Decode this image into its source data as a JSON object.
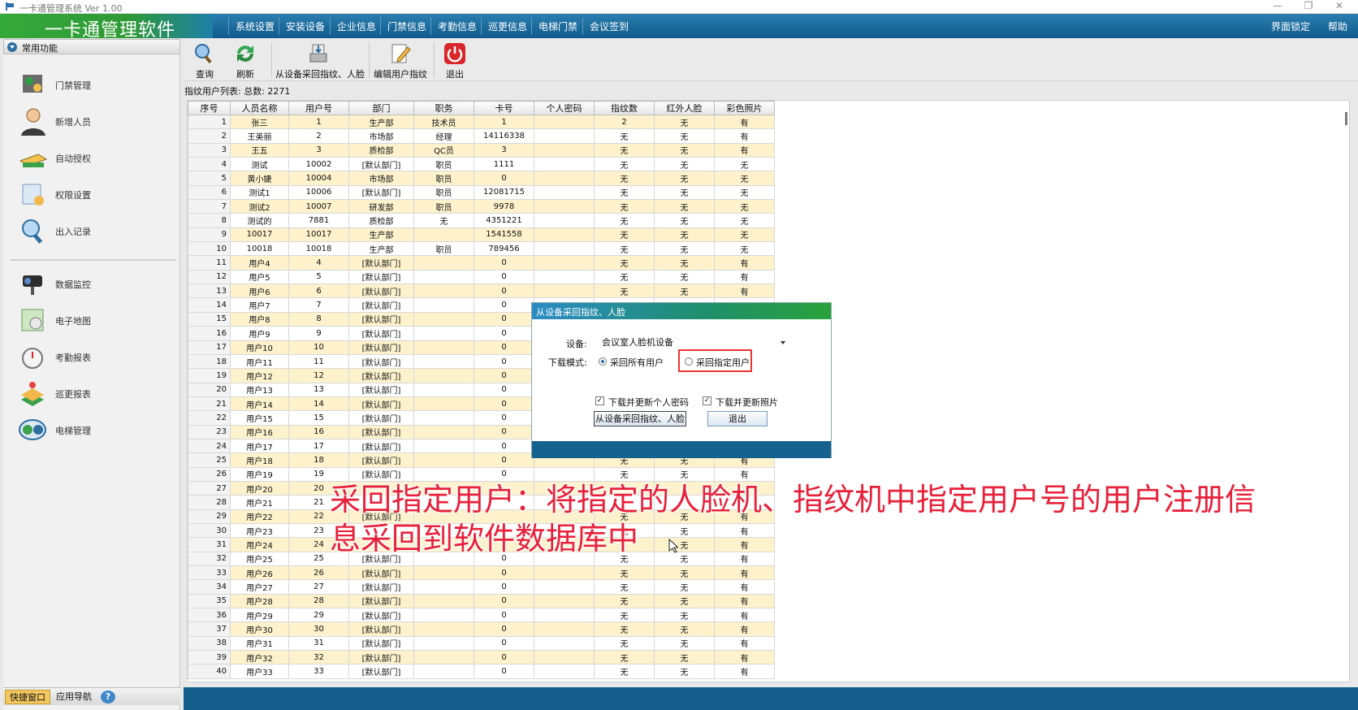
{
  "window": {
    "title": "一卡通管理系统  Ver 1.00",
    "min": "—",
    "max": "❐",
    "close": "✕"
  },
  "app": {
    "logo_text": "一卡通管理软件"
  },
  "menu": {
    "items": [
      "系统设置",
      "安装设备",
      "企业信息",
      "门禁信息",
      "考勤信息",
      "巡更信息",
      "电梯门禁",
      "会议签到"
    ],
    "right_items": [
      "界面锁定",
      "帮助"
    ]
  },
  "sidebar": {
    "header": "常用功能",
    "items": [
      {
        "label": "门禁管理",
        "icon": "door-access-icon"
      },
      {
        "label": "新增人员",
        "icon": "person-icon"
      },
      {
        "label": "自动授权",
        "icon": "card-icon"
      },
      {
        "label": "权限设置",
        "icon": "permission-icon"
      },
      {
        "label": "出入记录",
        "icon": "magnifier-icon"
      },
      {
        "label": "数据监控",
        "icon": "camera-icon"
      },
      {
        "label": "电子地图",
        "icon": "map-icon"
      },
      {
        "label": "考勤报表",
        "icon": "clock-icon"
      },
      {
        "label": "巡更报表",
        "icon": "patrol-icon"
      },
      {
        "label": "电梯管理",
        "icon": "elevator-icon"
      }
    ],
    "bottom_tabs": [
      "快捷窗口",
      "应用导航"
    ],
    "help_icon": "?"
  },
  "toolbar": {
    "buttons": [
      {
        "label": "查询",
        "icon": "search-icon"
      },
      {
        "label": "刷新",
        "icon": "refresh-icon"
      },
      {
        "label": "从设备采回指纹、人脸",
        "icon": "download-device-icon"
      },
      {
        "label": "编辑用户指纹",
        "icon": "edit-icon"
      },
      {
        "label": "退出",
        "icon": "power-icon"
      }
    ]
  },
  "list": {
    "label": "指纹用户列表: 总数: 2271",
    "columns": [
      "序号",
      "人员名称",
      "用户号",
      "部门",
      "职务",
      "卡号",
      "个人密码",
      "指纹数",
      "红外人脸",
      "彩色照片"
    ],
    "rows": [
      [
        "1",
        "张三",
        "1",
        "生产部",
        "技术员",
        "1",
        "",
        "2",
        "无",
        "有"
      ],
      [
        "2",
        "王美丽",
        "2",
        "市场部",
        "经理",
        "14116338",
        "",
        "无",
        "无",
        "有"
      ],
      [
        "3",
        "王五",
        "3",
        "质检部",
        "QC员",
        "3",
        "",
        "无",
        "无",
        "有"
      ],
      [
        "4",
        "测试",
        "10002",
        "[默认部门]",
        "职员",
        "1111",
        "",
        "无",
        "无",
        "无"
      ],
      [
        "5",
        "黄小婕",
        "10004",
        "市场部",
        "职员",
        "0",
        "",
        "无",
        "无",
        "无"
      ],
      [
        "6",
        "测试1",
        "10006",
        "[默认部门]",
        "职员",
        "12081715",
        "",
        "无",
        "无",
        "无"
      ],
      [
        "7",
        "测试2",
        "10007",
        "研发部",
        "职员",
        "9978",
        "",
        "无",
        "无",
        "无"
      ],
      [
        "8",
        "测试的",
        "7881",
        "质检部",
        "无",
        "4351221",
        "",
        "无",
        "无",
        "无"
      ],
      [
        "9",
        "10017",
        "10017",
        "生产部",
        "",
        "1541558",
        "",
        "无",
        "无",
        "无"
      ],
      [
        "10",
        "10018",
        "10018",
        "生产部",
        "职员",
        "789456",
        "",
        "无",
        "无",
        "无"
      ],
      [
        "11",
        "用户4",
        "4",
        "[默认部门]",
        "",
        "0",
        "",
        "无",
        "无",
        "有"
      ],
      [
        "12",
        "用户5",
        "5",
        "[默认部门]",
        "",
        "0",
        "",
        "无",
        "无",
        "有"
      ],
      [
        "13",
        "用户6",
        "6",
        "[默认部门]",
        "",
        "0",
        "",
        "无",
        "无",
        "有"
      ],
      [
        "14",
        "用户7",
        "7",
        "[默认部门]",
        "",
        "0",
        "",
        "",
        "",
        ""
      ],
      [
        "15",
        "用户8",
        "8",
        "[默认部门]",
        "",
        "0",
        "",
        "",
        "",
        ""
      ],
      [
        "16",
        "用户9",
        "9",
        "[默认部门]",
        "",
        "0",
        "",
        "",
        "",
        ""
      ],
      [
        "17",
        "用户10",
        "10",
        "[默认部门]",
        "",
        "0",
        "",
        "",
        "",
        ""
      ],
      [
        "18",
        "用户11",
        "11",
        "[默认部门]",
        "",
        "0",
        "",
        "",
        "",
        ""
      ],
      [
        "19",
        "用户12",
        "12",
        "[默认部门]",
        "",
        "0",
        "",
        "",
        "",
        ""
      ],
      [
        "20",
        "用户13",
        "13",
        "[默认部门]",
        "",
        "0",
        "",
        "",
        "",
        ""
      ],
      [
        "21",
        "用户14",
        "14",
        "[默认部门]",
        "",
        "0",
        "",
        "",
        "",
        ""
      ],
      [
        "22",
        "用户15",
        "15",
        "[默认部门]",
        "",
        "0",
        "",
        "",
        "",
        ""
      ],
      [
        "23",
        "用户16",
        "16",
        "[默认部门]",
        "",
        "0",
        "",
        "",
        "",
        ""
      ],
      [
        "24",
        "用户17",
        "17",
        "[默认部门]",
        "",
        "0",
        "",
        "",
        "",
        ""
      ],
      [
        "25",
        "用户18",
        "18",
        "[默认部门]",
        "",
        "0",
        "",
        "无",
        "无",
        "有"
      ],
      [
        "26",
        "用户19",
        "19",
        "[默认部门]",
        "",
        "0",
        "",
        "无",
        "无",
        "有"
      ],
      [
        "27",
        "用户20",
        "20",
        "",
        "",
        "",
        "",
        "",
        "",
        ""
      ],
      [
        "28",
        "用户21",
        "21",
        "",
        "",
        "",
        "",
        "",
        "",
        ""
      ],
      [
        "29",
        "用户22",
        "22",
        "[默认部门]",
        "",
        "",
        "",
        "无",
        "无",
        "有"
      ],
      [
        "30",
        "用户23",
        "23",
        "",
        "",
        "",
        "",
        "无",
        "无",
        "有"
      ],
      [
        "31",
        "用户24",
        "24",
        "",
        "",
        "",
        "",
        "",
        "无",
        "有"
      ],
      [
        "32",
        "用户25",
        "25",
        "[默认部门]",
        "",
        "0",
        "",
        "无",
        "无",
        "有"
      ],
      [
        "33",
        "用户26",
        "26",
        "[默认部门]",
        "",
        "0",
        "",
        "无",
        "无",
        "有"
      ],
      [
        "34",
        "用户27",
        "27",
        "[默认部门]",
        "",
        "0",
        "",
        "无",
        "无",
        "有"
      ],
      [
        "35",
        "用户28",
        "28",
        "[默认部门]",
        "",
        "0",
        "",
        "无",
        "无",
        "有"
      ],
      [
        "36",
        "用户29",
        "29",
        "[默认部门]",
        "",
        "0",
        "",
        "无",
        "无",
        "有"
      ],
      [
        "37",
        "用户30",
        "30",
        "[默认部门]",
        "",
        "0",
        "",
        "无",
        "无",
        "有"
      ],
      [
        "38",
        "用户31",
        "31",
        "[默认部门]",
        "",
        "0",
        "",
        "无",
        "无",
        "有"
      ],
      [
        "39",
        "用户32",
        "32",
        "[默认部门]",
        "",
        "0",
        "",
        "无",
        "无",
        "有"
      ],
      [
        "40",
        "用户33",
        "33",
        "[默认部门]",
        "",
        "0",
        "",
        "无",
        "无",
        "有"
      ]
    ]
  },
  "dialog": {
    "title": "从设备采回指纹、人脸",
    "device_label": "设备:",
    "device_value": "会议室人脸机设备",
    "mode_label": "下载模式:",
    "mode_all": "采回所有用户",
    "mode_specific": "采回指定用户",
    "mode_selected": "all",
    "chk_password": "下载并更新个人密码",
    "chk_photo": "下载并更新照片",
    "chk_password_checked": true,
    "chk_photo_checked": true,
    "btn_fetch": "从设备采回指纹、人脸",
    "btn_exit": "退出"
  },
  "caption": {
    "line1": "采回指定用户：将指定的人脸机、指纹机中指定用户号的用户注册信",
    "line2": "息采回到软件数据库中"
  },
  "colors": {
    "menubar": "#1b6a9a",
    "logo": "#35a83b",
    "highlight_row": "#fdf2cc",
    "caption": "#e8203a",
    "red_box": "#e33333"
  }
}
